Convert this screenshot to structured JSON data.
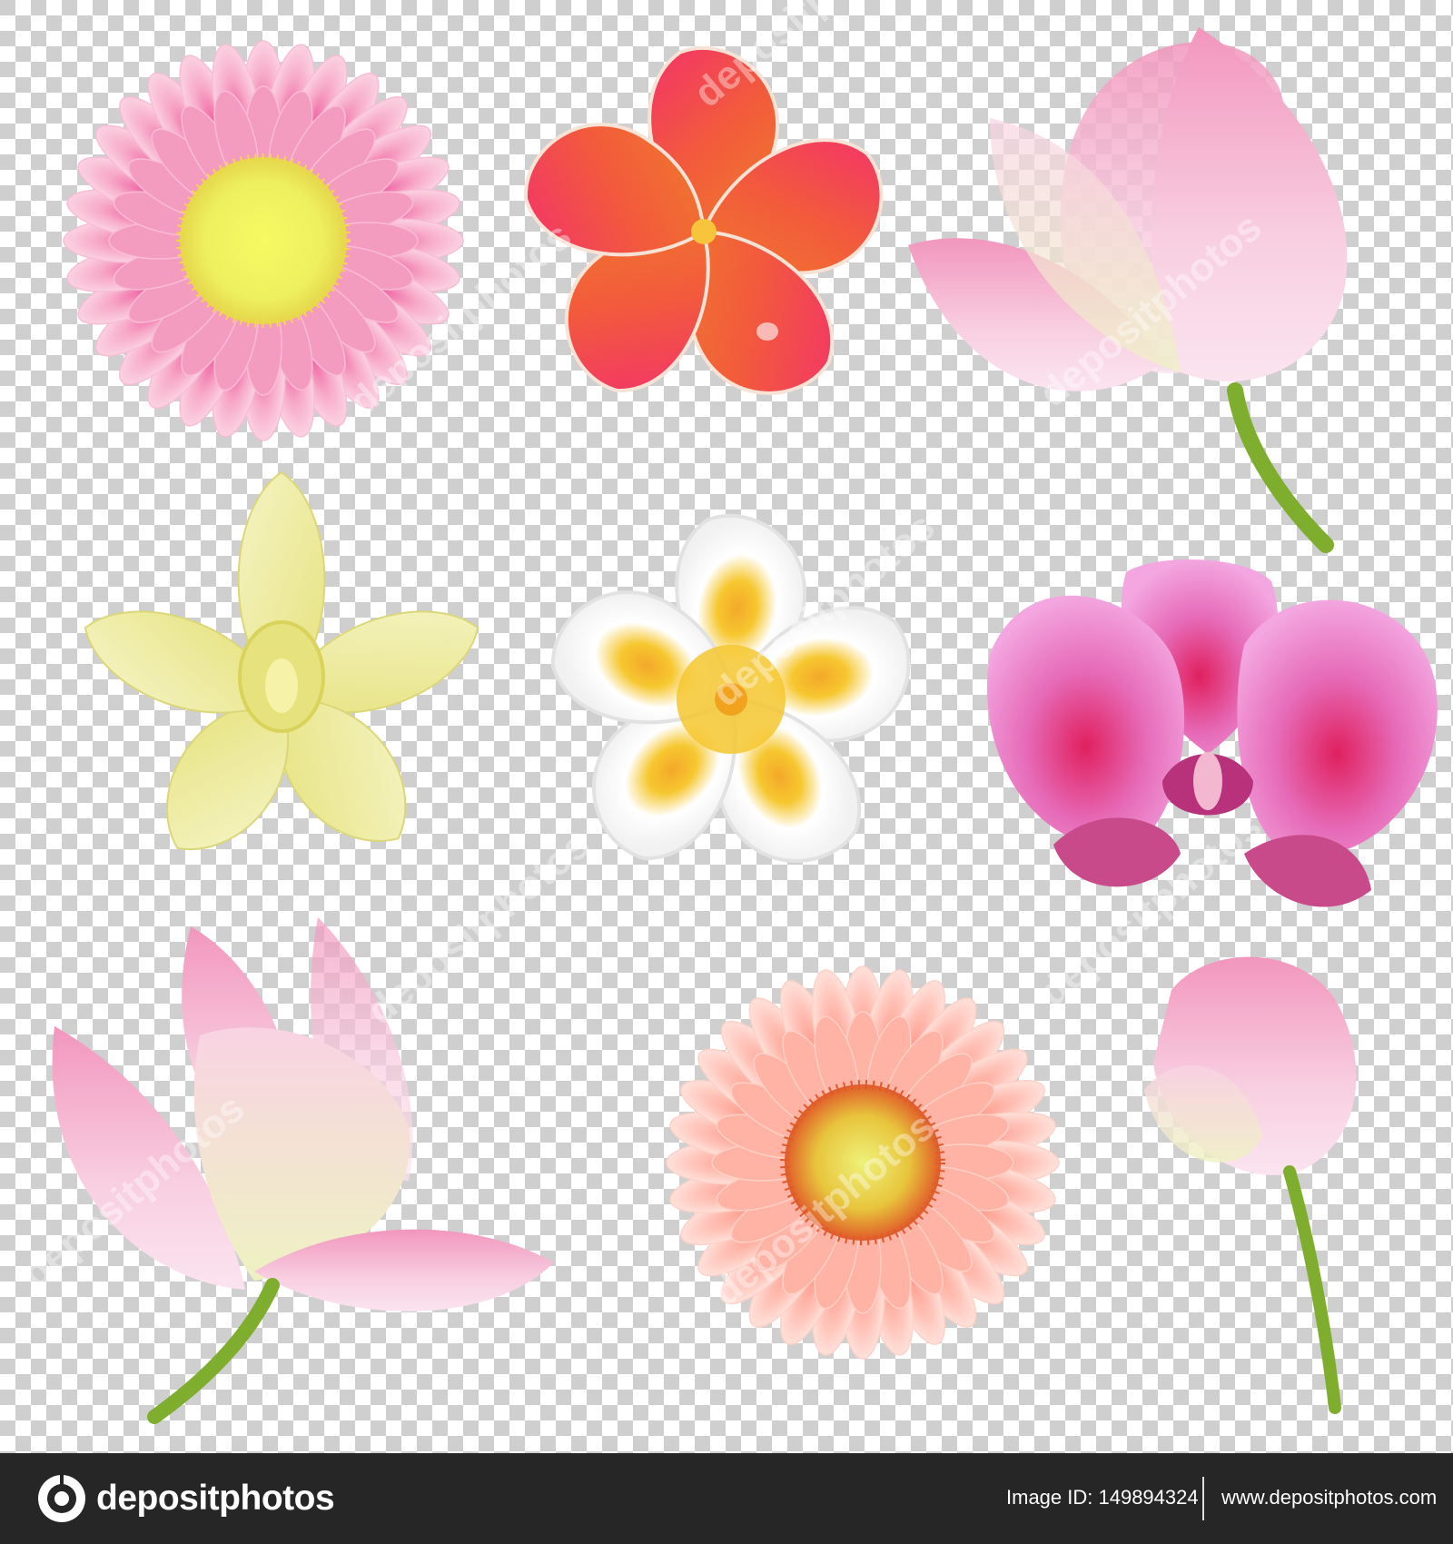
{
  "artwork": {
    "colors": {
      "checker_light": "#ffffff",
      "checker_dark": "#cfcfcf",
      "gerbera_pink": "#f7a9c7",
      "gerbera_center": "#eef060",
      "frangipani_red": "#f25a3c",
      "lotus_pink": "#f6c6dc",
      "stem_green": "#7fae2e",
      "orchid_yellow": "#f1f0b0",
      "frangipani_white": "#ffffff",
      "frangipani_yellow": "#f6c72f",
      "orchid_magenta": "#e66ab7",
      "gerbera_peach": "#ffc4ba",
      "gerbera_orange_dots": "#e05a2a"
    },
    "watermark": {
      "text": "depositphotos"
    },
    "flowers": [
      {
        "name": "pink gerbera"
      },
      {
        "name": "red frangipani"
      },
      {
        "name": "pink lotus"
      },
      {
        "name": "yellow orchid"
      },
      {
        "name": "white frangipani"
      },
      {
        "name": "magenta orchid"
      },
      {
        "name": "pink lotus flower"
      },
      {
        "name": "peach gerbera"
      },
      {
        "name": "lotus bud"
      }
    ]
  },
  "footer": {
    "logo_text": "depositphotos",
    "image_id": "Image ID: 149894324",
    "site_url": "www.depositphotos.com",
    "background": "#262626"
  }
}
